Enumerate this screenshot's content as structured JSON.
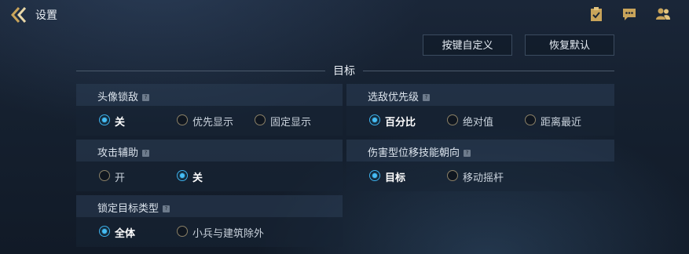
{
  "header": {
    "title": "设置",
    "icons": [
      "back-arrow-icon",
      "clipboard-icon",
      "chat-icon",
      "friends-icon"
    ]
  },
  "actions": {
    "custom_keys": "按键自定义",
    "restore_default": "恢复默认"
  },
  "section": {
    "title": "目标"
  },
  "panels": [
    {
      "title": "头像锁敌",
      "help": "?",
      "options": [
        "关",
        "优先显示",
        "固定显示"
      ],
      "selected": "关"
    },
    {
      "title": "选敌优先级",
      "help": "?",
      "options": [
        "百分比",
        "绝对值",
        "距离最近"
      ],
      "selected": "百分比"
    },
    {
      "title": "攻击辅助",
      "help": "?",
      "options": [
        "开",
        "关"
      ],
      "selected": "关"
    },
    {
      "title": "伤害型位移技能朝向",
      "help": "?",
      "options": [
        "目标",
        "移动摇杆"
      ],
      "selected": "目标"
    },
    {
      "title": "锁定目标类型",
      "help": "?",
      "options": [
        "全体",
        "小兵与建筑除外"
      ],
      "selected": "全体"
    }
  ],
  "colors": {
    "selected_radio": "#46bdf5",
    "unselected_radio_border": "#8a8067",
    "background": "#15202f"
  }
}
